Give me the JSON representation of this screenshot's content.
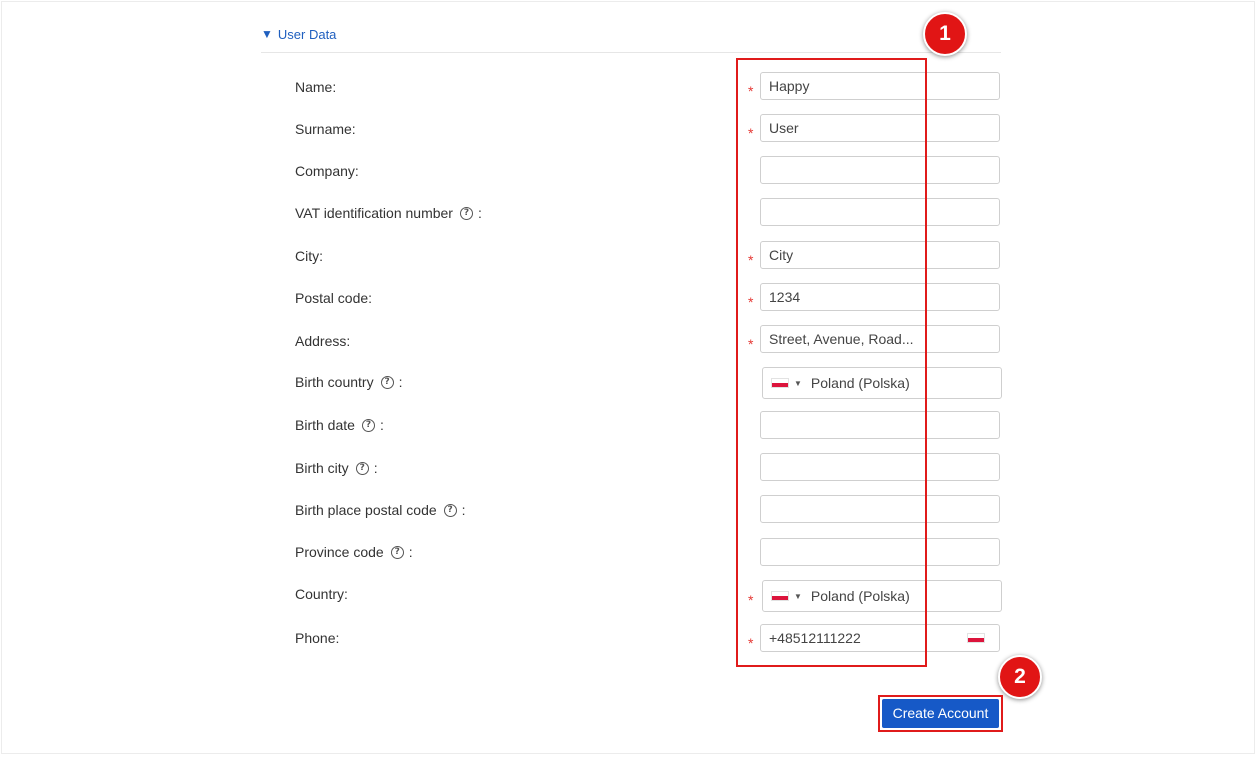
{
  "section": {
    "arrow": "▼",
    "title": "User Data"
  },
  "fields": {
    "name": {
      "label": "Name:",
      "value": "Happy",
      "required": "*"
    },
    "surname": {
      "label": "Surname:",
      "value": "User",
      "required": "*"
    },
    "company": {
      "label": "Company:",
      "value": ""
    },
    "vat": {
      "label": "VAT identification number",
      "suffix": ":",
      "value": ""
    },
    "city": {
      "label": "City:",
      "value": "City",
      "required": "*"
    },
    "postal": {
      "label": "Postal code:",
      "value": "1234",
      "required": "*"
    },
    "address": {
      "label": "Address:",
      "value": "Street, Avenue, Road...",
      "required": "*"
    },
    "birth_country": {
      "label": "Birth country",
      "suffix": ":",
      "value": "Poland (Polska)"
    },
    "birth_date": {
      "label": "Birth date",
      "suffix": ":",
      "value": ""
    },
    "birth_city": {
      "label": "Birth city",
      "suffix": ":",
      "value": ""
    },
    "birth_postal": {
      "label": "Birth place postal code",
      "suffix": ":",
      "value": ""
    },
    "province": {
      "label": "Province code",
      "suffix": ":",
      "value": ""
    },
    "country": {
      "label": "Country:",
      "value": "Poland (Polska)",
      "required": "*"
    },
    "phone": {
      "label": "Phone:",
      "value": "+48512111222",
      "required": "*"
    }
  },
  "help_glyph": "?",
  "caret": "▼",
  "submit": {
    "label": "Create Account"
  },
  "annotations": {
    "badge1": "1",
    "badge2": "2"
  },
  "colors": {
    "accent": "#1659c7",
    "link": "#1f5fbf",
    "required": "#e53935",
    "highlight": "#e01b1b"
  },
  "icons": {
    "help": "question-circle-icon",
    "flag": "poland-flag-icon"
  }
}
